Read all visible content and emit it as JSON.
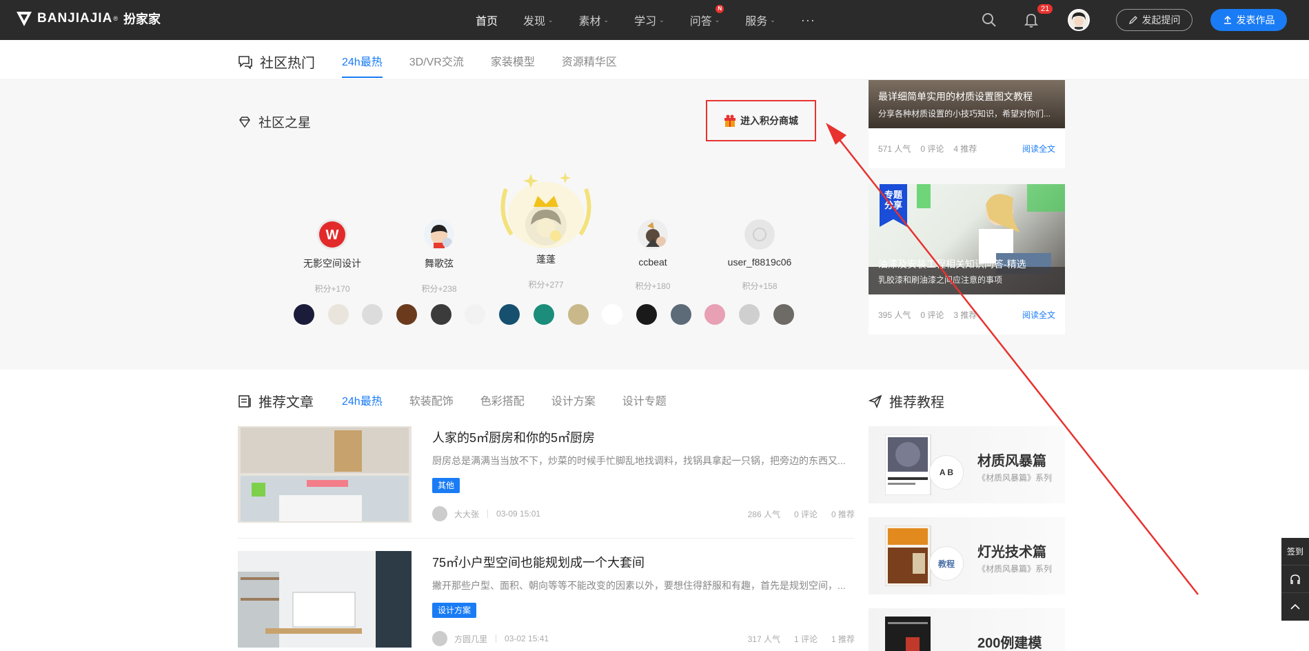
{
  "brand": {
    "name_en": "BANJIAJIA",
    "reg": "®",
    "name_cn": "扮家家"
  },
  "nav": {
    "items": [
      {
        "label": "首页",
        "active": true,
        "dropdown": false
      },
      {
        "label": "发现",
        "active": false,
        "dropdown": true
      },
      {
        "label": "素材",
        "active": false,
        "dropdown": true
      },
      {
        "label": "学习",
        "active": false,
        "dropdown": true
      },
      {
        "label": "问答",
        "active": false,
        "dropdown": true,
        "badge": "N"
      },
      {
        "label": "服务",
        "active": false,
        "dropdown": true
      }
    ],
    "more": "···",
    "notification_count": "21",
    "ask_button": "发起提问",
    "publish_button": "发表作品"
  },
  "subnav": {
    "title": "社区热门",
    "tabs": [
      "24h最热",
      "3D/VR交流",
      "家装模型",
      "资源精华区"
    ]
  },
  "community_stars": {
    "title": "社区之星",
    "mall_button": "进入积分商城",
    "top": [
      {
        "name": "无影空间设计",
        "points": "积分+170",
        "rank": 4
      },
      {
        "name": "舞歌弦",
        "points": "积分+238",
        "rank": 2
      },
      {
        "name": "蓬蓬",
        "points": "积分+277",
        "rank": 1
      },
      {
        "name": "ccbeat",
        "points": "积分+180",
        "rank": 3
      },
      {
        "name": "user_f8819c06",
        "points": "积分+158",
        "rank": 5
      }
    ],
    "more_avatar_colors": [
      "#1b1b3a",
      "#e9e4dc",
      "#dcdcdc",
      "#6b3a1d",
      "#3b3b3b",
      "#f2f2f2",
      "#17506f",
      "#1b8d7a",
      "#c9b98a",
      "#ffffff",
      "#1a1a1a",
      "#5d6a78",
      "#e8a0b4",
      "#cfcfcf",
      "#6e6a66"
    ]
  },
  "right_cards": [
    {
      "title": "最详细简单实用的材质设置图文教程",
      "desc": "分享各种材质设置的小技巧知识，希望对你们...",
      "views": "571 人气",
      "comments": "0 评论",
      "recommends": "4 推荐",
      "read": "阅读全文"
    },
    {
      "badge": "专题\n分享",
      "title": "油漆及安装工程相关知识问答-精选",
      "desc": "乳胶漆和刷油漆之间应注意的事项",
      "views": "395 人气",
      "comments": "0 评论",
      "recommends": "3 推荐",
      "read": "阅读全文"
    }
  ],
  "articles_section": {
    "title": "推荐文章",
    "tabs": [
      "24h最热",
      "软装配饰",
      "色彩搭配",
      "设计方案",
      "设计专题"
    ]
  },
  "articles": [
    {
      "title": "人家的5㎡厨房和你的5㎡厨房",
      "desc": "厨房总是满满当当放不下，炒菜的时候手忙脚乱地找调料，找锅具拿起一只锅，把旁边的东西又...",
      "tag": "其他",
      "author": "大大张",
      "time": "03-09 15:01",
      "views": "286 人气",
      "comments": "0 评论",
      "recommends": "0 推荐"
    },
    {
      "title": "75㎡小户型空间也能规划成一个大套间",
      "desc": "撇开那些户型、面积、朝向等等不能改变的因素以外，要想住得舒服和有趣，首先是规划空间，...",
      "tag": "设计方案",
      "author": "方圆几里",
      "time": "03-02 15:41",
      "views": "317 人气",
      "comments": "1 评论",
      "recommends": "1 推荐"
    }
  ],
  "tutorials_section": {
    "title": "推荐教程"
  },
  "tutorials": [
    {
      "title": "材质风暴篇",
      "subtitle": "《材质风暴篇》系列",
      "circle": "A B"
    },
    {
      "title": "灯光技术篇",
      "subtitle": "《材质风暴篇》系列",
      "circle": "教程"
    },
    {
      "title": "200例建模",
      "subtitle": "",
      "circle": ""
    }
  ],
  "side_float": {
    "checkin": "签到"
  },
  "colors": {
    "accent": "#1a7cf5",
    "topbar": "#2b2b2b",
    "annotation": "#e8322f"
  }
}
